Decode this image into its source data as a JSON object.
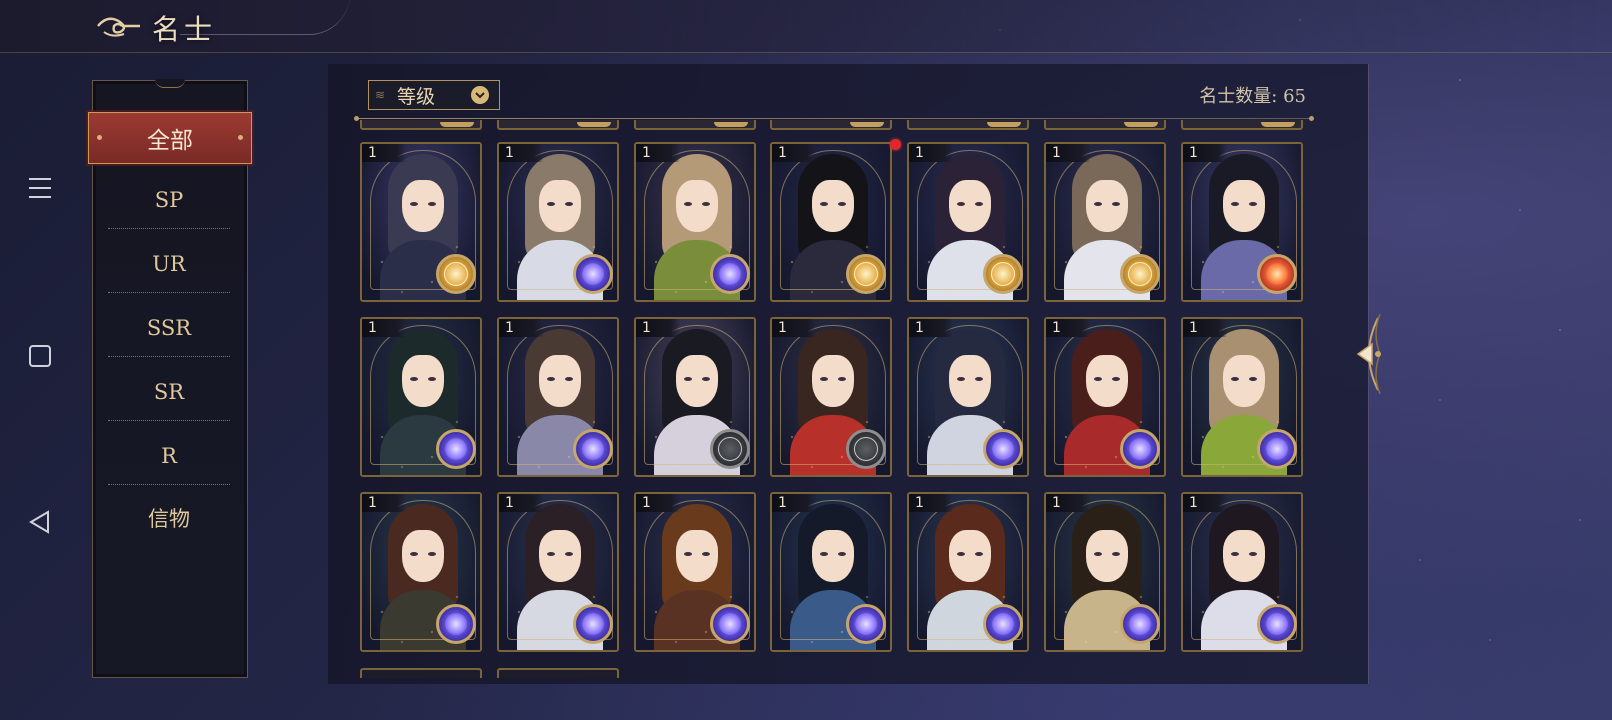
{
  "header": {
    "title": "名士"
  },
  "system_nav": {
    "menu_icon": "menu-icon",
    "home_icon": "square-home-icon",
    "back_icon": "triangle-back-icon"
  },
  "filters": {
    "active": "全部",
    "items": [
      "SP",
      "UR",
      "SSR",
      "SR",
      "R",
      "信物"
    ]
  },
  "sort": {
    "label": "等级",
    "icon": "chevron-down-icon"
  },
  "count": {
    "text": "名士数量: 65",
    "value": 65
  },
  "cards": [
    {
      "level": "1",
      "badge": "gold",
      "hair": "#3a3a52",
      "body": "#2b2e48",
      "bg": "#3a3a6a"
    },
    {
      "level": "1",
      "badge": "purple",
      "hair": "#8a7a6a",
      "body": "#d8dbe6",
      "bg": "#2c2f54"
    },
    {
      "level": "1",
      "badge": "purple",
      "hair": "#b59a78",
      "body": "#7a8d3a",
      "bg": "#3a3550"
    },
    {
      "level": "1",
      "badge": "gold",
      "hair": "#141418",
      "body": "#2b2a3c",
      "bg": "#232848"
    },
    {
      "level": "1",
      "badge": "gold",
      "hair": "#2b2238",
      "body": "#dfe1ea",
      "bg": "#2a2e54"
    },
    {
      "level": "1",
      "badge": "gold",
      "hair": "#7a6858",
      "body": "#e4e4ec",
      "bg": "#2d3052"
    },
    {
      "level": "1",
      "badge": "orange",
      "hair": "#1a1a26",
      "body": "#6a6aa8",
      "bg": "#3a3c6a"
    },
    {
      "level": "1",
      "badge": "purple",
      "hair": "#1c2a2c",
      "body": "#2a3a40",
      "bg": "#243046"
    },
    {
      "level": "1",
      "badge": "purple",
      "hair": "#4a3a34",
      "body": "#8a88a8",
      "bg": "#2a2c4c"
    },
    {
      "level": "1",
      "badge": "dark",
      "hair": "#1a1a22",
      "body": "#d6d0dc",
      "bg": "#4a4660"
    },
    {
      "level": "1",
      "badge": "dark",
      "hair": "#3a2620",
      "body": "#b8302a",
      "bg": "#2e3046"
    },
    {
      "level": "1",
      "badge": "purple",
      "hair": "#262a40",
      "body": "#cfd4e0",
      "bg": "#2a3a58"
    },
    {
      "level": "1",
      "badge": "purple",
      "hair": "#4a1e1a",
      "body": "#a82a2a",
      "bg": "#2a3350"
    },
    {
      "level": "1",
      "badge": "purple",
      "hair": "#a89070",
      "body": "#8aa83a",
      "bg": "#2a3648"
    },
    {
      "level": "1",
      "badge": "purple",
      "hair": "#4a2a20",
      "body": "#3a3a30",
      "bg": "#2a3a4e"
    },
    {
      "level": "1",
      "badge": "purple",
      "hair": "#2a2026",
      "body": "#d6d8e2",
      "bg": "#2c3552"
    },
    {
      "level": "1",
      "badge": "purple",
      "hair": "#6a3a1c",
      "body": "#5a3224",
      "bg": "#2c3150"
    },
    {
      "level": "1",
      "badge": "purple",
      "hair": "#141a2a",
      "body": "#3a5a8a",
      "bg": "#233652"
    },
    {
      "level": "1",
      "badge": "purple",
      "hair": "#5a2a1c",
      "body": "#d0d6de",
      "bg": "#2a3954"
    },
    {
      "level": "1",
      "badge": "purple",
      "hair": "#2a2018",
      "body": "#c8b48a",
      "bg": "#2a3a4a"
    },
    {
      "level": "1",
      "badge": "purple",
      "hair": "#201820",
      "body": "#dcdde8",
      "bg": "#2c3552"
    }
  ],
  "peek_rows": {
    "top_count": 7,
    "bottom_count": 2
  },
  "notification_dot_color": "#e2262c"
}
